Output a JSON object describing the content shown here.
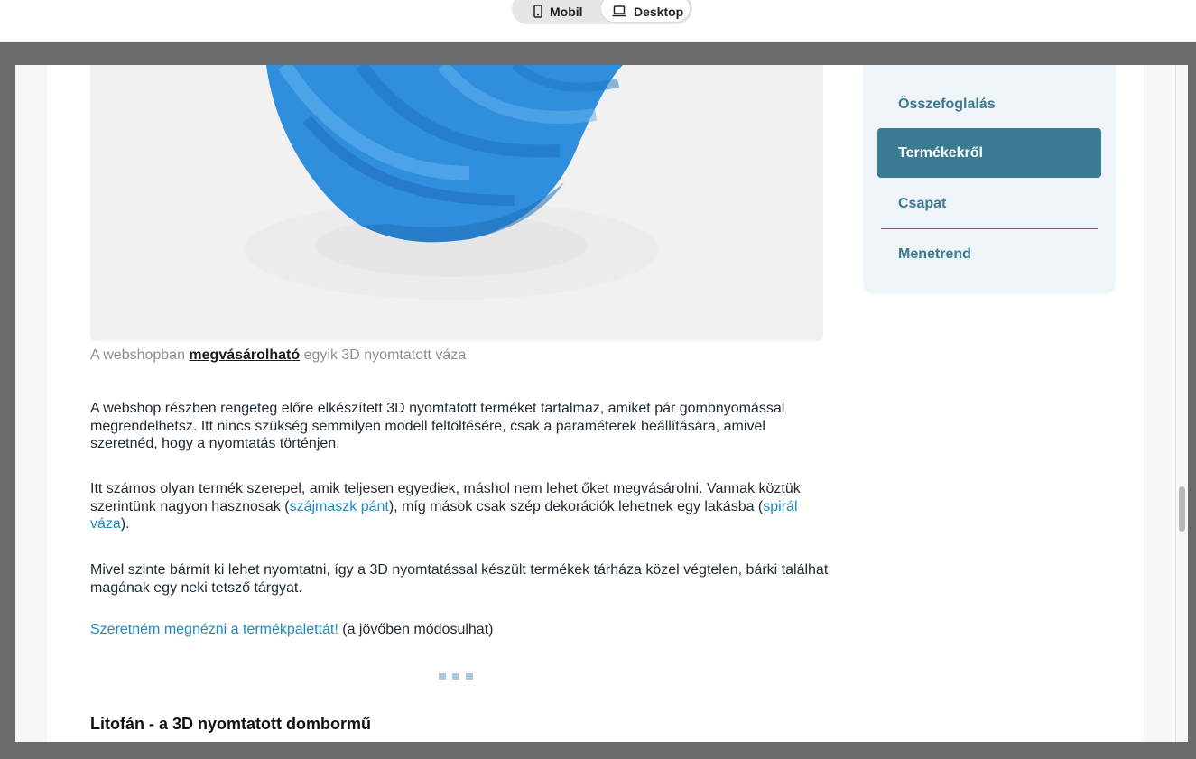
{
  "viewport_toggle": {
    "mobil_label": "Mobil",
    "desktop_label": "Desktop",
    "selected": "Desktop"
  },
  "article": {
    "image_caption": {
      "before": "A webshopban ",
      "link": "megvásárolható",
      "after": " egyik 3D nyomtatott váza"
    },
    "paragraph1": "A webshop részben rengeteg előre elkészített 3D nyomtatott terméket tartalmaz, amiket pár gombnyomással megrendelhetsz. Itt nincs szükség semmilyen modell feltöltésére, csak a paraméterek beállítására, amivel szeretnéd, hogy a nyomtatás történjen.",
    "paragraph2": {
      "part1": "Itt számos olyan termék szerepel, amik teljesen egyediek, máshol nem lehet őket megvásárolni. Vannak köztük szerintünk nagyon hasznosak (",
      "link1": "szájmaszk pánt",
      "part2": "), míg mások csak szép dekorációk lehetnek egy lakásba (",
      "link2": "spirál váza",
      "part3": ")."
    },
    "paragraph3": "Mivel szinte bármit ki lehet nyomtatni, így a 3D nyomtatással készült termékek tárháza közel végtelen, bárki találhat magának egy neki tetsző tárgyat.",
    "cta": {
      "link": "Szeretném megnézni a termékpalettát!",
      "note": " (a jövőben módosulhat)"
    },
    "section_heading": "Litofán - a 3D nyomtatott dombormű"
  },
  "toc": {
    "items": [
      {
        "label": "Összefoglalás",
        "active": false
      },
      {
        "label": "Termékekről",
        "active": true
      },
      {
        "label": "Csapat",
        "active": false
      },
      {
        "label": "Menetrend",
        "active": false
      }
    ]
  },
  "colors": {
    "accent": "#3b7a93",
    "link": "#1a8bc4",
    "toc_background": "#eef4f7",
    "vase_blue": "#2f8fdc"
  }
}
